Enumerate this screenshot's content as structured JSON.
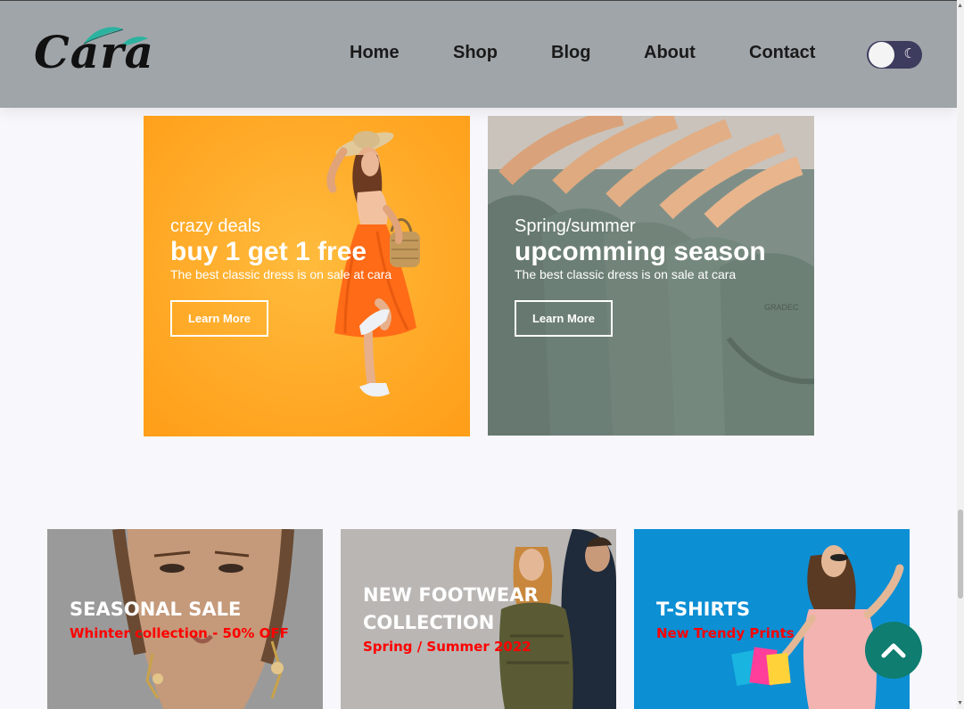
{
  "brand": {
    "logo_text": "Cara"
  },
  "nav": {
    "items": [
      "Home",
      "Shop",
      "Blog",
      "About",
      "Contact"
    ]
  },
  "banners": [
    {
      "kicker": "crazy deals",
      "title": "buy 1 get 1 free",
      "desc": "The best classic dress is on sale at cara",
      "button": "Learn More"
    },
    {
      "kicker": "Spring/summer",
      "title": "upcomming season",
      "desc": "The best classic dress is on sale at cara",
      "button": "Learn More"
    }
  ],
  "cards": [
    {
      "title": "SEASONAL SALE",
      "subtitle": "Whinter collection - 50% OFF"
    },
    {
      "title_line1": "NEW FOOTWEAR",
      "title_line2": "COLLECTION",
      "subtitle": "Spring / Summer 2022"
    },
    {
      "title": "T-SHIRTS",
      "subtitle": "New Trendy Prints"
    }
  ],
  "colors": {
    "header": "#a0a5a9",
    "accent": "#0f7d70",
    "card_subtitle": "#ff0000",
    "toggle": "#3d3b5e"
  },
  "icons": {
    "theme_toggle": "moon-icon",
    "back_to_top": "chevron-up-icon"
  }
}
